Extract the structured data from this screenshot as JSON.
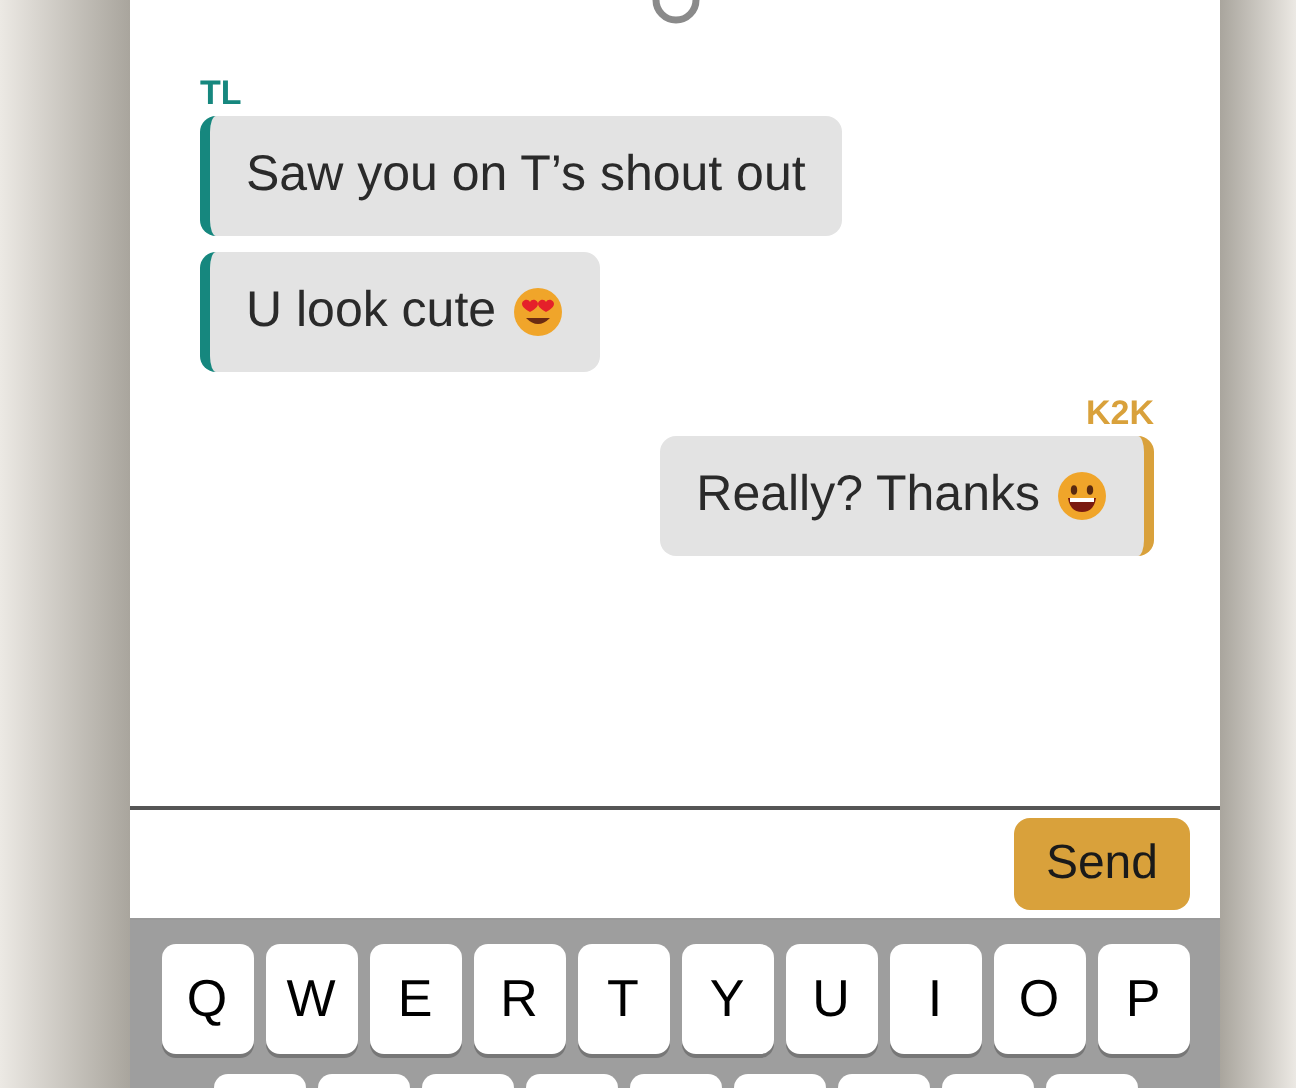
{
  "chat": [
    {
      "sender": "TL",
      "kind": "incoming",
      "color": "#16877e",
      "messages": [
        {
          "text": "Saw you on T’s shout out",
          "kind": "plain"
        },
        {
          "text": "U look cute",
          "kind": "heart"
        }
      ]
    },
    {
      "sender": "K2K",
      "kind": "outgoing",
      "color": "#d9a13b",
      "messages": [
        {
          "text": "Really? Thanks",
          "kind": "grin"
        }
      ]
    }
  ],
  "composer": {
    "send_button": "Send"
  },
  "keyboard": {
    "top_row": [
      "Q",
      "W",
      "E",
      "R",
      "T",
      "Y",
      "U",
      "I",
      "O",
      "P"
    ]
  }
}
